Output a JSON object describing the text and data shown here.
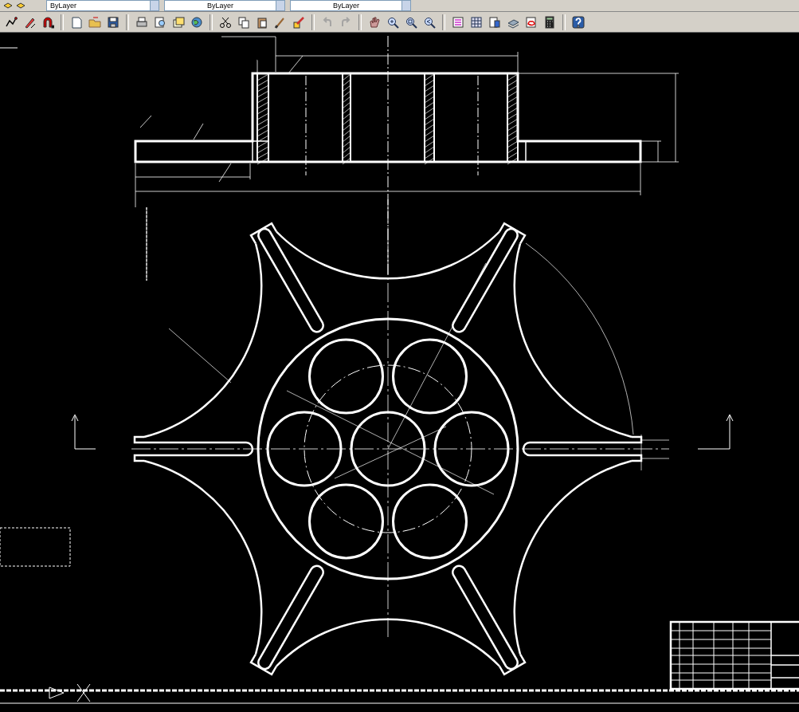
{
  "toolbar_top": {
    "layer_dropdowns": [
      "ByLayer",
      "ByLayer",
      "ByLayer"
    ]
  },
  "toolbar": {
    "buttons": [
      {
        "kind": "polyline",
        "disabled": false
      },
      {
        "kind": "snap",
        "disabled": false
      },
      {
        "kind": "magnet",
        "disabled": false
      },
      {
        "kind": "sep"
      },
      {
        "kind": "new",
        "disabled": false
      },
      {
        "kind": "open",
        "disabled": false
      },
      {
        "kind": "save",
        "disabled": false
      },
      {
        "kind": "sep"
      },
      {
        "kind": "print",
        "disabled": false
      },
      {
        "kind": "preview",
        "disabled": false
      },
      {
        "kind": "publish",
        "disabled": false
      },
      {
        "kind": "globe",
        "disabled": false
      },
      {
        "kind": "sep"
      },
      {
        "kind": "cut",
        "disabled": false
      },
      {
        "kind": "copy",
        "disabled": false
      },
      {
        "kind": "paste",
        "disabled": false
      },
      {
        "kind": "brush",
        "disabled": false
      },
      {
        "kind": "block",
        "disabled": false
      },
      {
        "kind": "sep"
      },
      {
        "kind": "undo",
        "disabled": true
      },
      {
        "kind": "redo",
        "disabled": true
      },
      {
        "kind": "sep"
      },
      {
        "kind": "pan",
        "disabled": false
      },
      {
        "kind": "zoom",
        "disabled": false
      },
      {
        "kind": "zoomwin",
        "disabled": false
      },
      {
        "kind": "zoomprev",
        "disabled": false
      },
      {
        "kind": "sep"
      },
      {
        "kind": "properties",
        "disabled": false
      },
      {
        "kind": "design",
        "disabled": false
      },
      {
        "kind": "palette",
        "disabled": false
      },
      {
        "kind": "sheet",
        "disabled": false
      },
      {
        "kind": "markup",
        "disabled": false
      },
      {
        "kind": "calc",
        "disabled": false
      },
      {
        "kind": "sep"
      },
      {
        "kind": "help",
        "disabled": false
      }
    ]
  }
}
